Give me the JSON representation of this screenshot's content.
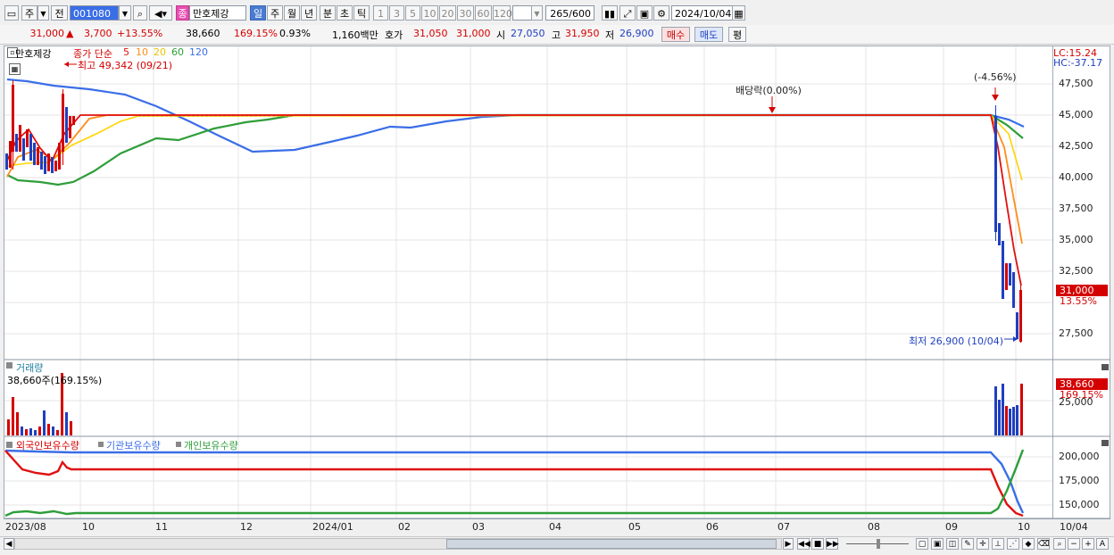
{
  "toolbar": {
    "type_selector": "주",
    "all_button": "전",
    "stock_code": "001080",
    "jong_badge": "종",
    "stock_name": "만호제강",
    "period_tabs": [
      "일",
      "주",
      "월",
      "년",
      "분",
      "초",
      "틱"
    ],
    "active_period": "일",
    "interval_buttons": [
      "1",
      "3",
      "5",
      "10",
      "20",
      "30",
      "60",
      "120"
    ],
    "count_value": "265",
    "count_total": "/600",
    "date_value": "2024/10/04"
  },
  "quote": {
    "price": "31,000",
    "change": "3,700",
    "change_pct": "+13.55%",
    "volume": "38,660",
    "volume_ratio": "169.15%",
    "turnover": "0.93%",
    "amount": "1,160백만",
    "ask_label": "호가",
    "ask": "31,050",
    "bid": "31,000",
    "open_label": "시",
    "open": "27,050",
    "high_label": "고",
    "high": "31,950",
    "low_label": "저",
    "low": "26,900",
    "buy_button": "매수",
    "sell_button": "매도",
    "avg_button": "평"
  },
  "colors": {
    "up": "#d40000",
    "down": "#1f3fbf",
    "ma5": "#e01010",
    "ma10": "#ff8c1a",
    "ma20": "#ffe000",
    "ma60": "#2e9e3a",
    "ma120": "#3a6ee8"
  },
  "price_panel": {
    "legend_name": "만호제강",
    "legend_ma_label": "종가 단순",
    "ma_periods": [
      "5",
      "10",
      "20",
      "60",
      "120"
    ],
    "high_note": "최고 49,342 (09/21)",
    "dividend_note": "배당락(0.00%)",
    "change_note": "(-4.56%)",
    "low_note": "최저 26,900 (10/04)",
    "lc": "LC:15.24",
    "hc": "HC:-37.17",
    "price_tag": "31,000",
    "pct_tag": "13.55%",
    "y_ticks": [
      "47,500",
      "45,000",
      "42,500",
      "40,000",
      "37,500",
      "35,000",
      "32,500",
      "27,500"
    ]
  },
  "volume_panel": {
    "title": "거래량",
    "value_note": "38,660주(169.15%)",
    "tag_value": "38,660",
    "tag_pct": "169.15%",
    "y_tick": "25,000"
  },
  "holdings_panel": {
    "legend": [
      "외국인보유수량",
      "기관보유수량",
      "개인보유수량"
    ],
    "y_ticks": [
      "200,000",
      "175,000",
      "150,000"
    ]
  },
  "x_axis": {
    "labels": [
      "2023/08",
      "10",
      "11",
      "12",
      "2024/01",
      "02",
      "03",
      "04",
      "05",
      "06",
      "07",
      "08",
      "09",
      "10"
    ],
    "right_label": "10/04"
  }
}
